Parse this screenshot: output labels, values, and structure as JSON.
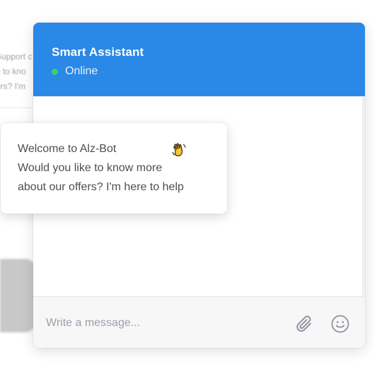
{
  "background": {
    "snippet_lines": [
      "Support c",
      "e to kno",
      "ers? I'm"
    ]
  },
  "header": {
    "title": "Smart Assistant",
    "status": "Online",
    "color": "#2a88e6",
    "status_color": "#35d46a"
  },
  "welcome": {
    "line1": "Welcome to Alz-Bot",
    "line2": "Would you like to know more",
    "line3": "about our offers? I'm here to help",
    "emoji": "waving-hand-icon"
  },
  "composer": {
    "placeholder": "Write a message...",
    "attach_icon": "paperclip-icon",
    "emoji_icon": "smiley-icon"
  }
}
